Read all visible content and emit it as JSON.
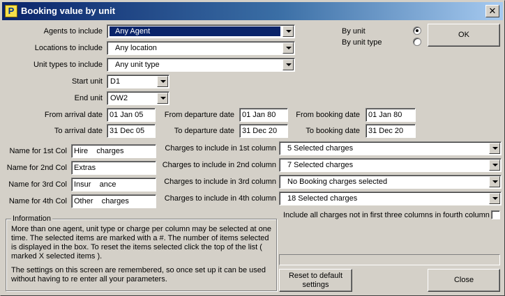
{
  "window": {
    "title": "Booking value by unit",
    "icon": "app-p-icon",
    "close_glyph": "✕"
  },
  "filters": {
    "agents": {
      "label": "Agents to include",
      "value": "Any Agent"
    },
    "locations": {
      "label": "Locations to include",
      "value": "Any location"
    },
    "unit_types": {
      "label": "Unit types to include",
      "value": "Any unit type"
    },
    "start_unit": {
      "label": "Start unit",
      "value": "D1"
    },
    "end_unit": {
      "label": "End unit",
      "value": "OW2"
    }
  },
  "mode": {
    "by_unit": {
      "label": "By unit",
      "selected": true
    },
    "by_unit_type": {
      "label": "By unit type",
      "selected": false
    }
  },
  "dates": {
    "from_arrival": {
      "label": "From arrival date",
      "value": "01 Jan 05"
    },
    "to_arrival": {
      "label": "To arrival date",
      "value": "31 Dec 05"
    },
    "from_departure": {
      "label": "From departure date",
      "value": "01 Jan 80"
    },
    "to_departure": {
      "label": "To departure date",
      "value": "31 Dec 20"
    },
    "from_booking": {
      "label": "From booking date",
      "value": "01 Jan 80"
    },
    "to_booking": {
      "label": "To booking date",
      "value": "31 Dec 20"
    }
  },
  "columns": [
    {
      "name_label": "Name for 1st Col",
      "name_value": "Hire    charges",
      "charges_label": "Charges to include in 1st column",
      "charges_value": "5 Selected charges"
    },
    {
      "name_label": "Name for 2nd Col",
      "name_value": "Extras",
      "charges_label": "Charges to include in 2nd column",
      "charges_value": "7 Selected charges"
    },
    {
      "name_label": "Name for 3rd Col",
      "name_value": "Insur    ance",
      "charges_label": "Charges to include in 3rd column",
      "charges_value": "No Booking charges selected"
    },
    {
      "name_label": "Name for 4th Col",
      "name_value": "Other    charges",
      "charges_label": "Charges to include in 4th column",
      "charges_value": "18 Selected charges"
    }
  ],
  "include_all": {
    "label": "Include all charges not in first three columns in fourth column",
    "checked": false
  },
  "info": {
    "title": "Information",
    "para1": "More than one agent, unit type or charge per column may be selected at one time.  The selected items are marked with a #.  The number of items selected is displayed in the box.  To reset the items selected click the top of the list ( marked X selected items ).",
    "para2": "The settings on this screen are remembered, so once set up it can be used without having to re enter all your parameters."
  },
  "buttons": {
    "ok": "OK",
    "reset": "Reset to default settings",
    "close": "Close"
  },
  "colors": {
    "face": "#d4d0c8",
    "title_start": "#0a246a",
    "title_end": "#a6caf0",
    "highlight": "#0a246a"
  }
}
